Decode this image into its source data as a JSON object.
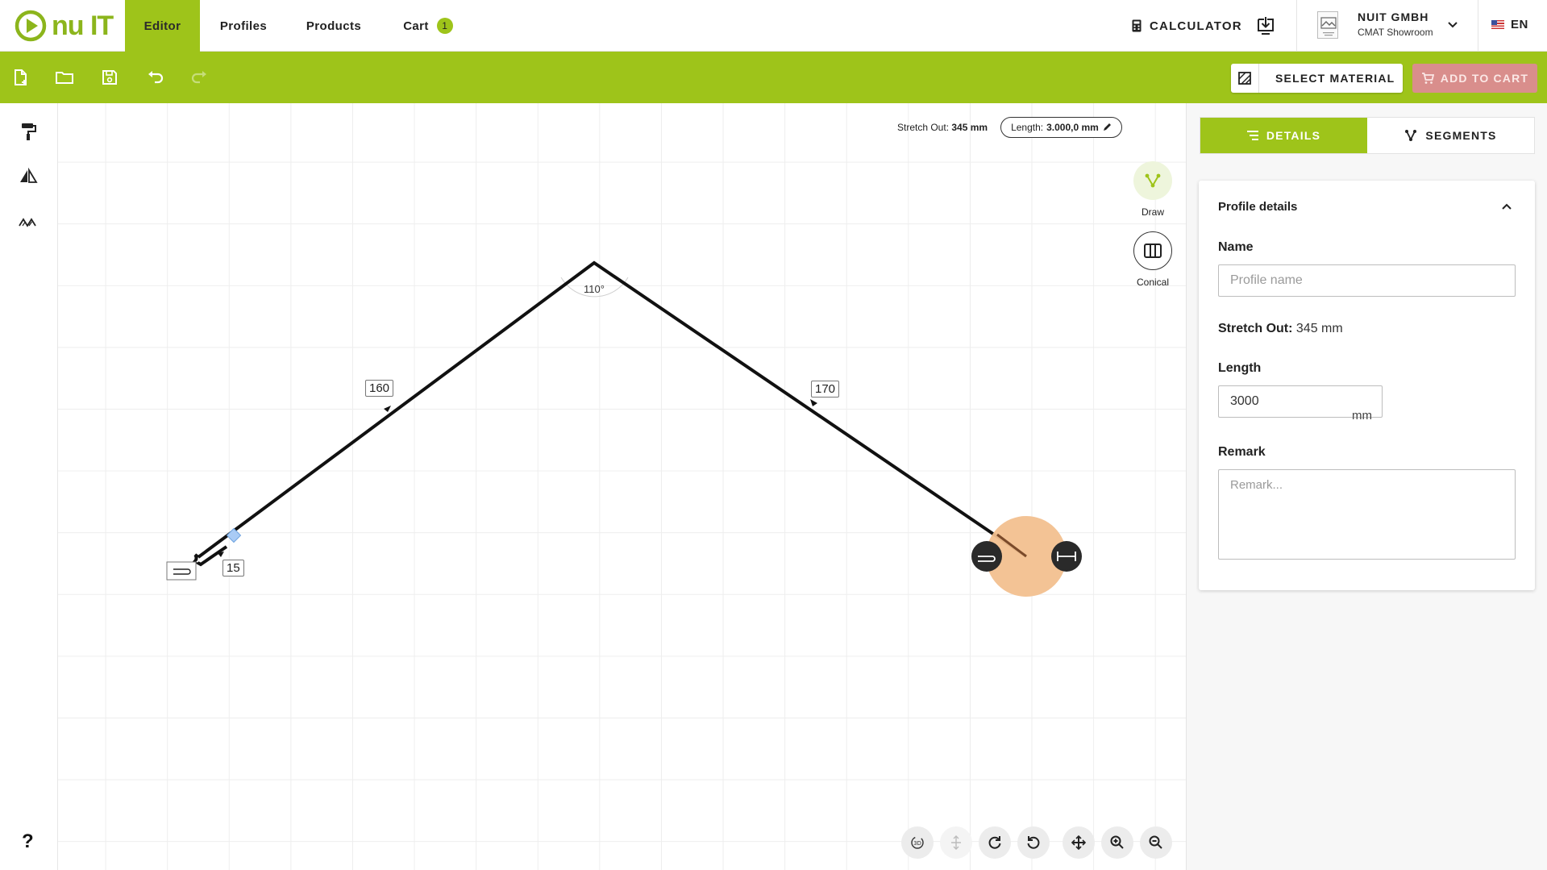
{
  "brand": {
    "logo_text": "nu IT",
    "accent": "#9ec41a",
    "cart_button_color": "#d98e8c",
    "handle_color": "#f2c08f"
  },
  "nav": {
    "tabs": [
      {
        "label": "Editor",
        "active": true
      },
      {
        "label": "Profiles",
        "active": false
      },
      {
        "label": "Products",
        "active": false
      },
      {
        "label": "Cart",
        "active": false
      }
    ],
    "cart_count": "1",
    "calculator_label": "CALCULATOR",
    "company_name": "NUIT GMBH",
    "company_sub": "CMAT Showroom",
    "language": "EN"
  },
  "toolbar": {
    "icons": [
      "new-file-icon",
      "open-folder-icon",
      "save-icon",
      "undo-icon",
      "redo-icon"
    ],
    "select_material_label": "SELECT MATERIAL",
    "add_to_cart_label": "ADD TO CART"
  },
  "left_tools": [
    "paint-roller-icon",
    "mirror-icon",
    "multiple-profiles-icon"
  ],
  "help_label": "?",
  "canvas": {
    "stretch_out_label": "Stretch Out:",
    "stretch_out_value": "345 mm",
    "length_label": "Length:",
    "length_value": "3.000,0 mm",
    "draw_label": "Draw",
    "conical_label": "Conical",
    "segments": [
      "160",
      "170",
      "15"
    ],
    "angle": "110°",
    "bottom_tools": [
      "3d-view-icon",
      "flip-icon",
      "rotate-clockwise-icon",
      "rotate-counterclockwise-icon",
      "pan-icon",
      "zoom-in-icon",
      "zoom-out-icon"
    ]
  },
  "panel": {
    "tab_details": "DETAILS",
    "tab_segments": "SEGMENTS",
    "card_title": "Profile details",
    "name_label": "Name",
    "name_placeholder": "Profile name",
    "stretch_label": "Stretch Out:",
    "stretch_value": "345 mm",
    "length_label": "Length",
    "length_value": "3000",
    "length_unit": "mm",
    "remark_label": "Remark",
    "remark_placeholder": "Remark..."
  }
}
